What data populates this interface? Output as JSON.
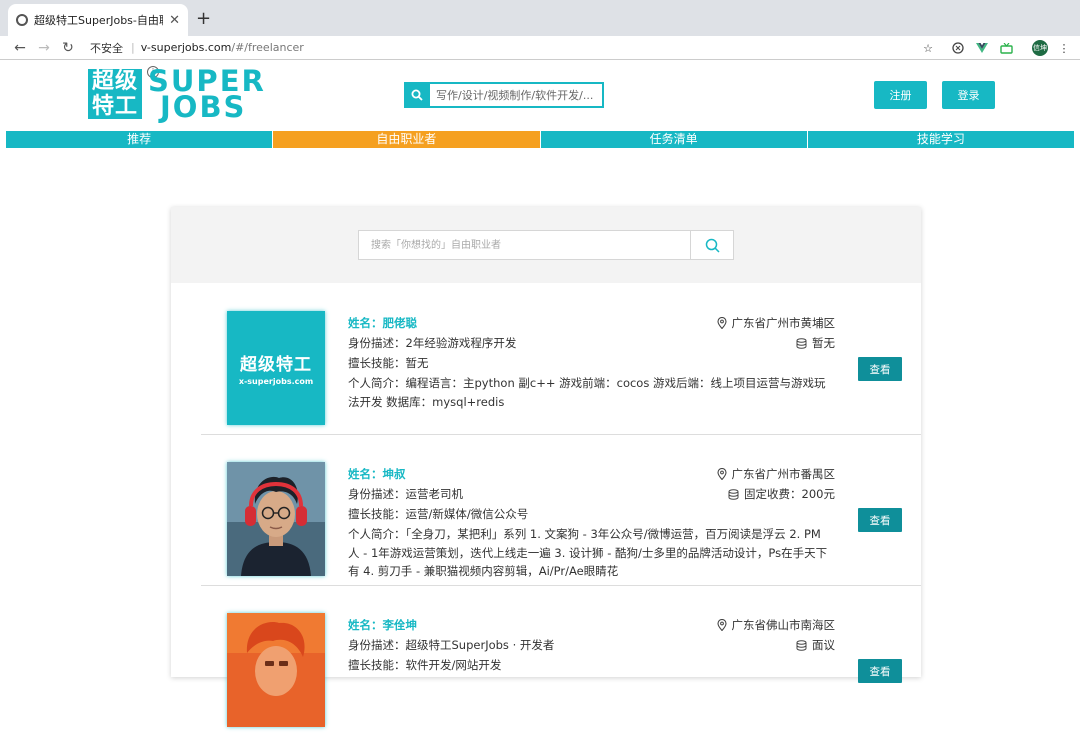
{
  "browser": {
    "tab_title": "超级特工SuperJobs-自由职业者",
    "address_security": "不安全",
    "address_host": "v-superjobs.com",
    "address_path": "/#/freelancer",
    "profile_initials": "信坤"
  },
  "site": {
    "logo_cn_line1": "超级",
    "logo_cn_line2": "特工",
    "logo_en_line1": "SUPER",
    "logo_en_line2": "JOBS",
    "search_placeholder": "写作/设计/视频制作/软件开发/...",
    "register_label": "注册",
    "login_label": "登录",
    "brand_color": "#17b8c4",
    "active_color": "#f5a020"
  },
  "nav": {
    "items": [
      {
        "label": "推荐",
        "active": false
      },
      {
        "label": "自由职业者",
        "active": true
      },
      {
        "label": "任务清单",
        "active": false
      },
      {
        "label": "技能学习",
        "active": false
      }
    ]
  },
  "freelancer_search": {
    "placeholder": "搜索「你想找的」自由职业者"
  },
  "freelancers": [
    {
      "name_prefix": "姓名：",
      "name": "肥佬聪",
      "identity": "身份描述：2年经验游戏程序开发",
      "skills": "擅长技能：暂无",
      "bio": "个人简介：编程语言：主python 副c++ 游戏前端：cocos 游戏后端：线上项目运营与游戏玩法开发 数据库：mysql+redis",
      "location": "广东省广州市黄埔区",
      "fee": "暂无",
      "view_label": "查看",
      "avatar_text": "超级特工",
      "avatar_subtext": "x-superjobs.com"
    },
    {
      "name_prefix": "姓名：",
      "name": "坤叔",
      "identity": "身份描述：运营老司机",
      "skills": "擅长技能：运营/新媒体/微信公众号",
      "bio": "个人简介：「全身刀，某把利」系列 1. 文案狗 - 3年公众号/微博运营，百万阅读是浮云 2. PM 人 - 1年游戏运营策划，迭代上线走一遍 3. 设计狮 - 酷狗/士多里的品牌活动设计，Ps在手天下有 4. 剪刀手 - 兼职猫视频内容剪辑，Ai/Pr/Ae眼睛花",
      "location": "广东省广州市番禺区",
      "fee": "固定收费：200元",
      "view_label": "查看"
    },
    {
      "name_prefix": "姓名：",
      "name": "李佺坤",
      "identity": "身份描述：超级特工SuperJobs · 开发者",
      "skills": "擅长技能：软件开发/网站开发",
      "bio": "",
      "location": "广东省佛山市南海区",
      "fee": "面议",
      "view_label": "查看"
    }
  ]
}
